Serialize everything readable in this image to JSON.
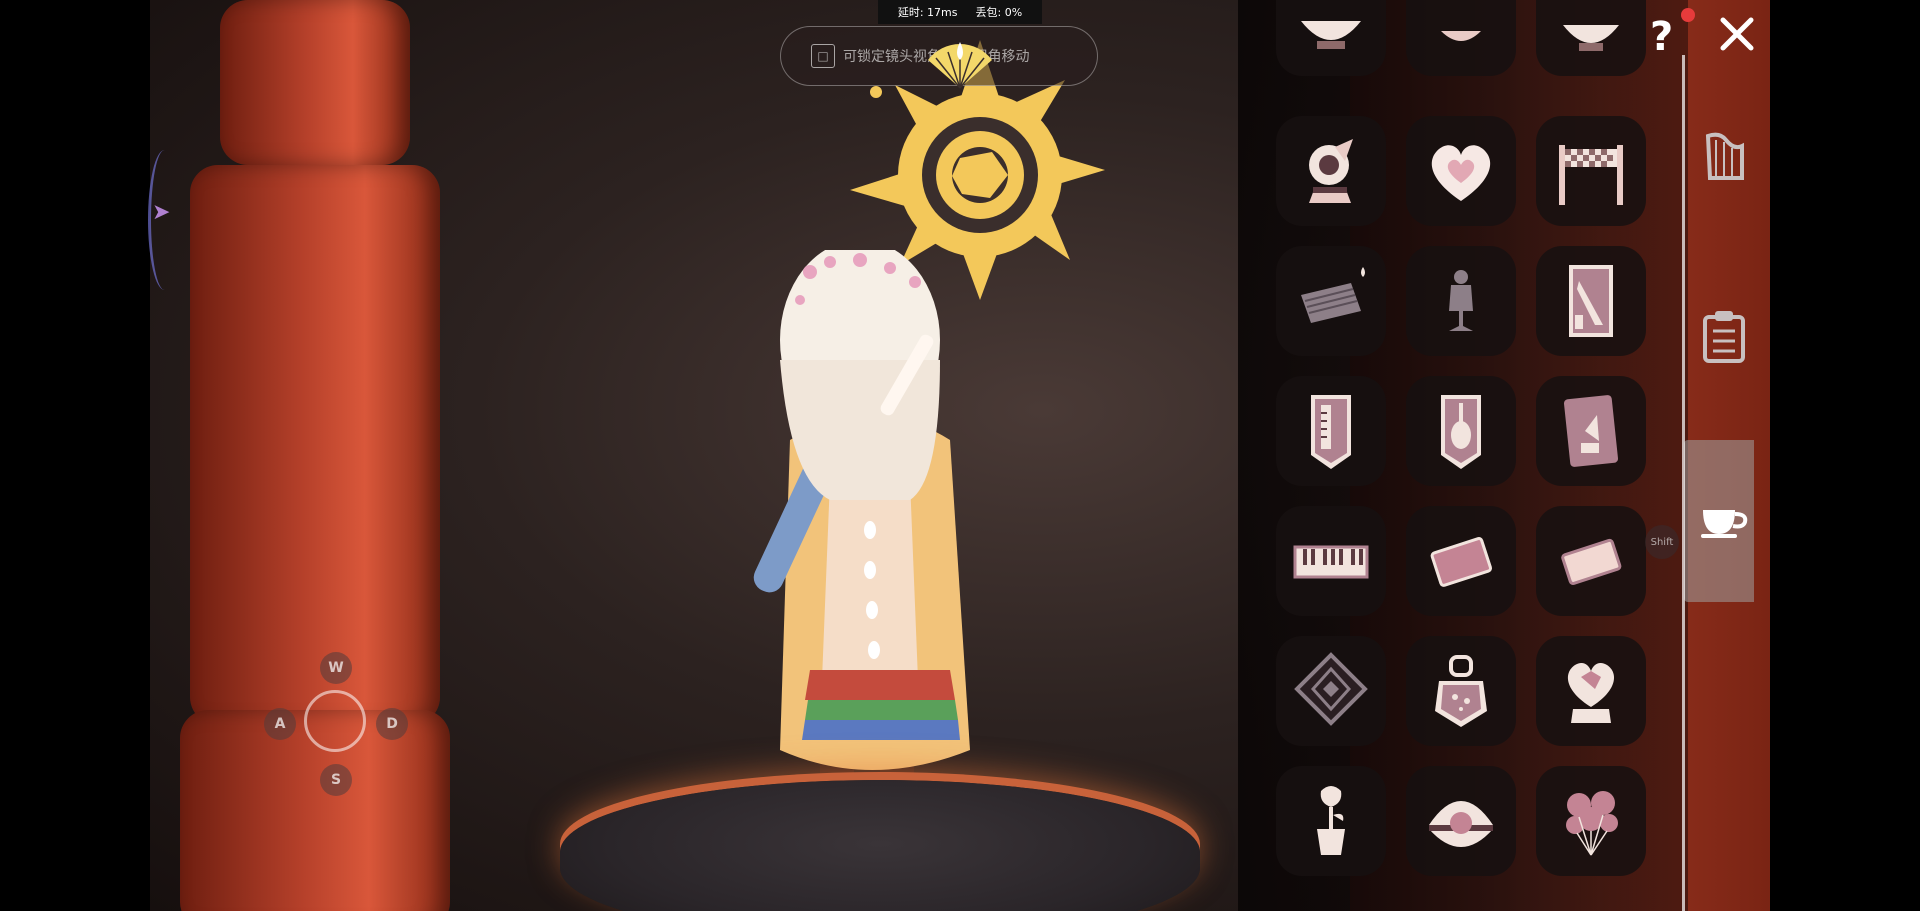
{
  "status": {
    "latency_label": "延时: 17ms",
    "packet_loss_label": "丢包: 0%"
  },
  "hint": {
    "key_icon": "lock-key-icon",
    "text": "可锁定镜头视角·自由视角移动"
  },
  "movement": {
    "up": "W",
    "left": "A",
    "right": "D",
    "down": "S"
  },
  "shift_key": "Shift",
  "top_buttons": {
    "help": "?",
    "help_badge_color": "#e63b3b",
    "close_icon": "close-icon"
  },
  "sidebar": {
    "tabs": [
      {
        "name": "instruments-tab",
        "icon": "harp-icon",
        "active": false
      },
      {
        "name": "clipboard-tab",
        "icon": "clipboard-icon",
        "active": false
      },
      {
        "name": "props-tab",
        "icon": "teacup-icon",
        "active": true
      }
    ]
  },
  "items": [
    [
      "bowl-icon",
      "bowl-icon",
      "cake-icon"
    ],
    [
      "snowglobe-icon",
      "heart-icon",
      "checker-gate-icon"
    ],
    [
      "mat-icon",
      "mannequin-icon",
      "poster-icon"
    ],
    [
      "banner-piano-icon",
      "banner-violin-icon",
      "banner-card-icon"
    ],
    [
      "piano-keyboard-icon",
      "pink-rug-icon",
      "beige-rug-icon"
    ],
    [
      "diamond-sign-icon",
      "lantern-icon",
      "heart-cake-icon"
    ],
    [
      "potted-rose-icon",
      "pearl-clam-icon",
      "balloons-icon"
    ]
  ],
  "colors": {
    "accent": "#e9cbc6",
    "icon_dark": "#5b3a40",
    "glyph": "#f3c85a"
  }
}
